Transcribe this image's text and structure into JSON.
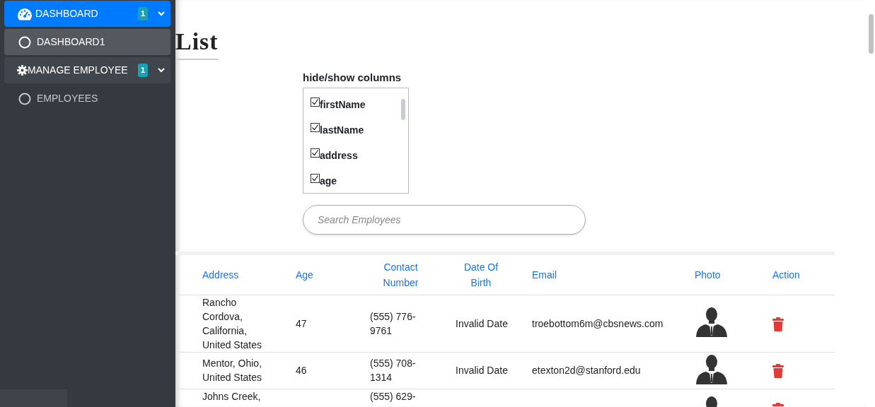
{
  "sidebar": {
    "items": [
      {
        "kind": "group",
        "label": "DASHBOARD",
        "badge": "1",
        "expanded": true,
        "selected": true
      },
      {
        "kind": "link",
        "label": "DASHBOARD1",
        "selected": true
      },
      {
        "kind": "group",
        "label": "MANAGE EMPLOYEE",
        "badge": "1",
        "expanded": true,
        "selected": false
      },
      {
        "kind": "link",
        "label": "EMPLOYEES",
        "selected": false
      }
    ]
  },
  "page": {
    "title": "List"
  },
  "columns_panel": {
    "title": "hide/show columns",
    "items": [
      {
        "label": "firstName",
        "checked": true
      },
      {
        "label": "lastName",
        "checked": true
      },
      {
        "label": "address",
        "checked": true
      },
      {
        "label": "age",
        "checked": true
      }
    ]
  },
  "search": {
    "placeholder": "Search Employees"
  },
  "table": {
    "columns": [
      "Address",
      "Age",
      "Contact Number",
      "Date Of Birth",
      "Email",
      "Photo",
      "Action"
    ],
    "rows": [
      {
        "address": "Rancho Cordova, California, United States",
        "age": "47",
        "contact": "(555) 776-9761",
        "dob": "Invalid Date",
        "email": "troebottom6m@cbsnews.com"
      },
      {
        "address": "Mentor, Ohio, United States",
        "age": "46",
        "contact": "(555) 708-1314",
        "dob": "Invalid Date",
        "email": "etexton2d@stanford.edu"
      },
      {
        "address": "Johns Creek,",
        "age": "",
        "contact": "(555) 629-",
        "dob": "",
        "email": ""
      }
    ]
  }
}
